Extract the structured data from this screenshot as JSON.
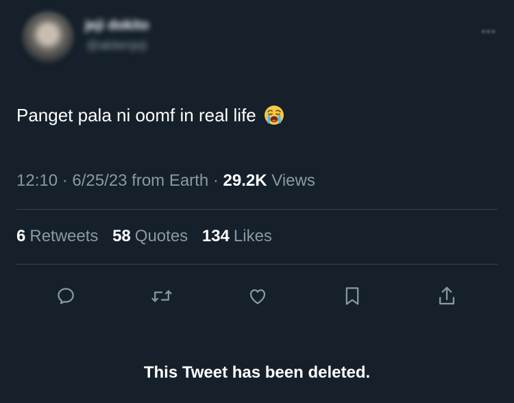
{
  "user": {
    "display_name": "jeji dokito",
    "handle": "@akitenjeji"
  },
  "tweet": {
    "text": "Panget pala ni oomf in real life",
    "emoji_icon": "loudly-crying-face-emoji"
  },
  "meta": {
    "time": "12:10",
    "date": "6/25/23",
    "source": "from Earth",
    "views_count": "29.2K",
    "views_label": "Views",
    "separator": "·"
  },
  "stats": {
    "retweets_count": "6",
    "retweets_label": "Retweets",
    "quotes_count": "58",
    "quotes_label": "Quotes",
    "likes_count": "134",
    "likes_label": "Likes"
  },
  "actions": [
    "reply-icon",
    "retweet-icon",
    "like-icon",
    "bookmark-icon",
    "share-icon"
  ],
  "colors": {
    "background": "#15202b",
    "text_primary": "#ffffff",
    "text_secondary": "#8b98a5",
    "divider": "#38444d",
    "icon": "#8b98a5"
  },
  "footer": {
    "deleted_notice": "This Tweet has been deleted."
  }
}
